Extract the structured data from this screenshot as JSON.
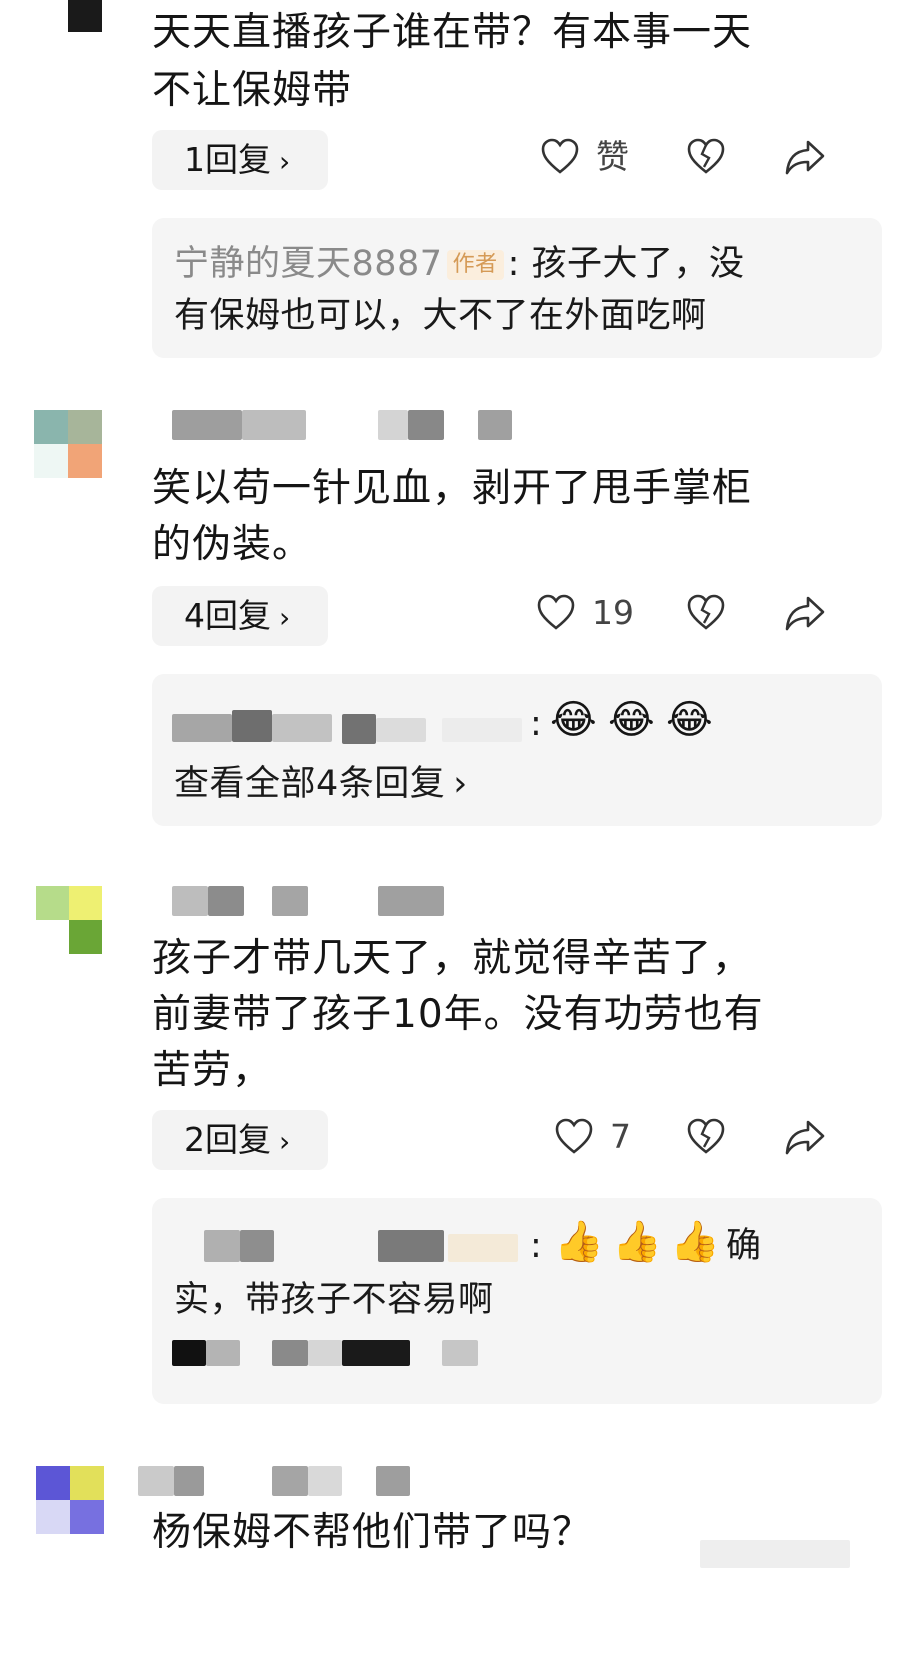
{
  "comments": [
    {
      "text_line1": "天天直播孩子谁在带？有本事一天",
      "text_line2": "不让保姆带",
      "reply_pill": "1回复",
      "like_label": "赞",
      "reply_preview": {
        "author": "宁静的夏天8887",
        "badge": "作者",
        "line1": ": 孩子大了，没",
        "line2": "有保姆也可以，大不了在外面吃啊"
      }
    },
    {
      "text_line1": "笑以苟一针见血，剥开了甩手掌柜",
      "text_line2": "的伪装。",
      "reply_pill": "4回复",
      "like_count": "19",
      "reply_preview": {
        "colon": ":",
        "emojis": [
          "😂",
          "😂",
          "😂"
        ],
        "view_all": "查看全部4条回复"
      }
    },
    {
      "text_line1": "孩子才带几天了，就觉得辛苦了，",
      "text_line2": "前妻带了孩子10年。没有功劳也有",
      "text_line3": "苦劳，",
      "reply_pill": "2回复",
      "like_count": "7",
      "reply_preview": {
        "colon": ":",
        "emojis": [
          "👍",
          "👍",
          "👍"
        ],
        "tail": "确",
        "line2": "实，带孩子不容易啊"
      }
    },
    {
      "text_line1": "杨保姆不帮他们带了吗？"
    }
  ],
  "chevron": "›",
  "icons": [
    "heart-icon",
    "broken-heart-icon",
    "share-icon",
    "chevron-right-icon"
  ],
  "colors": {
    "pill_bg": "#f3f3f3",
    "reply_bg": "#f5f5f5",
    "author": "#8a8a8a",
    "badge_bg": "#fbeedd",
    "badge_fg": "#d59a56"
  }
}
